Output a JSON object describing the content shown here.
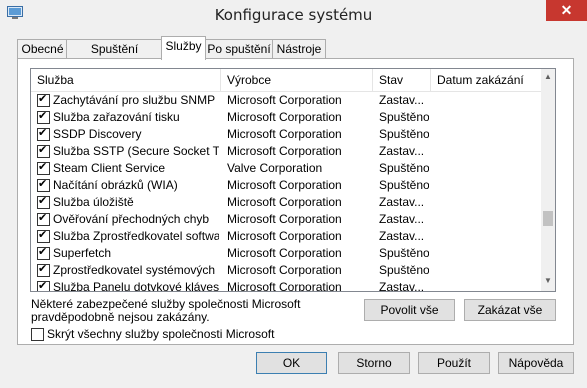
{
  "window": {
    "title": "Konfigurace systému",
    "close_glyph": "✕",
    "icon": "msconfig-icon"
  },
  "tabs": [
    {
      "label": "Obecné",
      "active": false
    },
    {
      "label": "Spuštění počítače",
      "active": false
    },
    {
      "label": "Služby",
      "active": true
    },
    {
      "label": "Po spuštění",
      "active": false
    },
    {
      "label": "Nástroje",
      "active": false
    }
  ],
  "table": {
    "headers": {
      "service": "Služba",
      "vendor": "Výrobce",
      "status": "Stav",
      "date": "Datum zakázání"
    },
    "rows": [
      {
        "checked": true,
        "service": "Zachytávání pro službu SNMP",
        "vendor": "Microsoft Corporation",
        "status": "Zastav..."
      },
      {
        "checked": true,
        "service": "Služba zařazování tisku",
        "vendor": "Microsoft Corporation",
        "status": "Spuštěno"
      },
      {
        "checked": true,
        "service": "SSDP Discovery",
        "vendor": "Microsoft Corporation",
        "status": "Spuštěno"
      },
      {
        "checked": true,
        "service": "Služba SSTP (Secure Socket Tun...",
        "vendor": "Microsoft Corporation",
        "status": "Zastav..."
      },
      {
        "checked": true,
        "service": "Steam Client Service",
        "vendor": "Valve Corporation",
        "status": "Spuštěno"
      },
      {
        "checked": true,
        "service": "Načítání obrázků (WIA)",
        "vendor": "Microsoft Corporation",
        "status": "Spuštěno"
      },
      {
        "checked": true,
        "service": "Služba úložiště",
        "vendor": "Microsoft Corporation",
        "status": "Zastav..."
      },
      {
        "checked": true,
        "service": "Ověřování přechodných chyb",
        "vendor": "Microsoft Corporation",
        "status": "Zastav..."
      },
      {
        "checked": true,
        "service": "Služba Zprostředkovatel softwar...",
        "vendor": "Microsoft Corporation",
        "status": "Zastav..."
      },
      {
        "checked": true,
        "service": "Superfetch",
        "vendor": "Microsoft Corporation",
        "status": "Spuštěno"
      },
      {
        "checked": true,
        "service": "Zprostředkovatel systémových ...",
        "vendor": "Microsoft Corporation",
        "status": "Spuštěno"
      },
      {
        "checked": true,
        "service": "Služba Panelu dotykové klávesni...",
        "vendor": "Microsoft Corporation",
        "status": "Zastav..."
      }
    ]
  },
  "note": "Některé zabezpečené služby společnosti Microsoft pravděpodobně nejsou zakázány.",
  "buttons": {
    "enable_all": "Povolit vše",
    "disable_all": "Zakázat vše",
    "ok": "OK",
    "cancel": "Storno",
    "apply": "Použít",
    "help": "Nápověda"
  },
  "hide_ms": {
    "label": "Skrýt všechny služby společnosti Microsoft",
    "checked": false
  },
  "colors": {
    "close": "#c7372f",
    "default_border": "#3c7fb1"
  }
}
